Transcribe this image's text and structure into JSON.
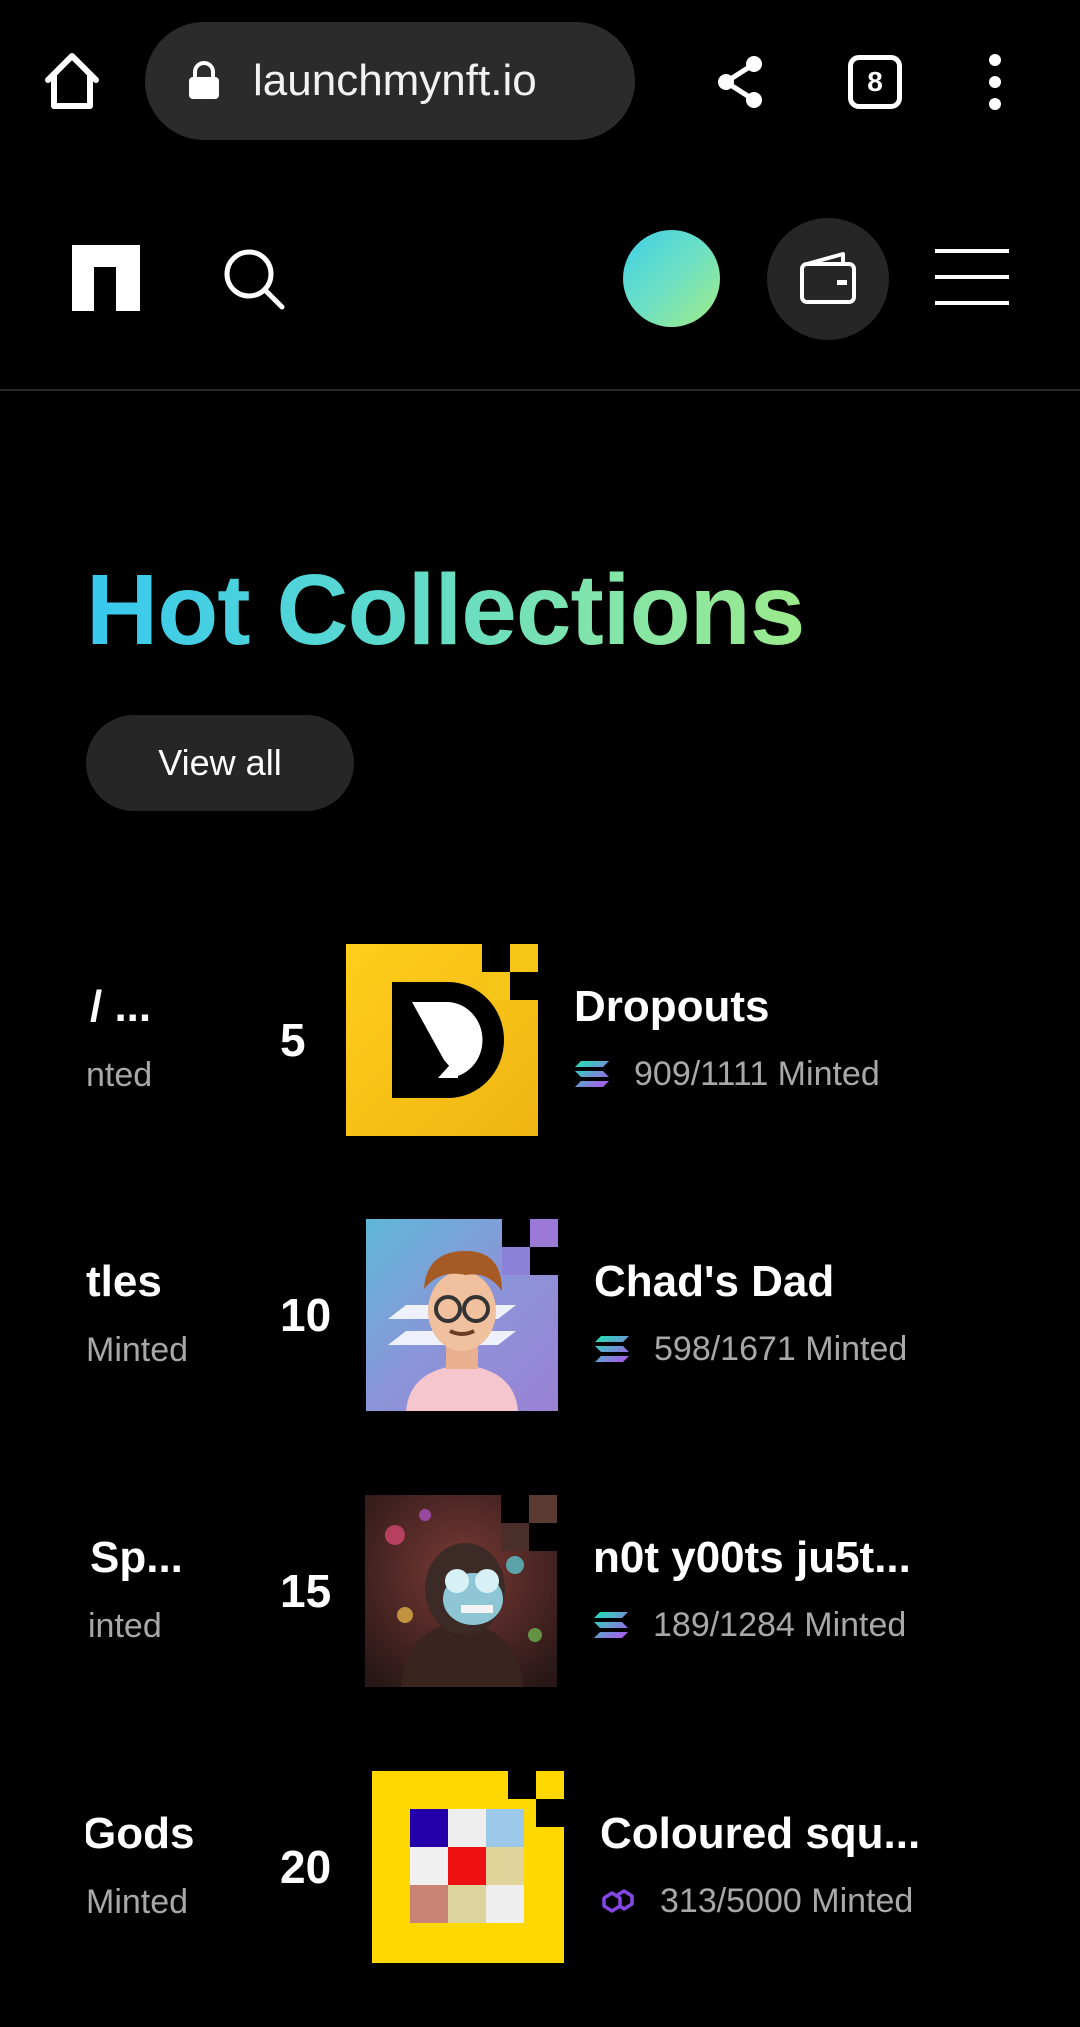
{
  "browser": {
    "url": "launchmynft.io",
    "tab_count": "8",
    "icons": [
      "home-icon",
      "lock-icon",
      "share-icon",
      "tabs-icon",
      "more-vert-icon"
    ]
  },
  "header": {
    "icons": [
      "logo",
      "search-icon",
      "avatar",
      "wallet-icon",
      "menu-icon"
    ],
    "avatar_gradient": [
      "#3ecfe6",
      "#a2ec85"
    ]
  },
  "hot_collections": {
    "title": "Hot Collections",
    "view_all_label": "View all",
    "title_gradient": [
      "#38c8ef",
      "#9bea8c"
    ],
    "rows": [
      {
        "prev_name": "/ ...",
        "prev_minted": "nted",
        "rank": "5",
        "name": "Dropouts",
        "minted": "909/1111 Minted",
        "chain": "solana-icon"
      },
      {
        "prev_name": "tles",
        "prev_minted": "Minted",
        "rank": "10",
        "name": "Chad's Dad",
        "minted": "598/1671 Minted",
        "chain": "solana-icon"
      },
      {
        "prev_name": "Sp...",
        "prev_minted": "inted",
        "rank": "15",
        "name": "n0t y00ts ju5t...",
        "minted": "189/1284 Minted",
        "chain": "solana-icon"
      },
      {
        "prev_name": "Gods",
        "prev_minted": "Minted",
        "rank": "20",
        "name": "Coloured squ...",
        "minted": "313/5000 Minted",
        "chain": "polygon-icon"
      }
    ]
  }
}
